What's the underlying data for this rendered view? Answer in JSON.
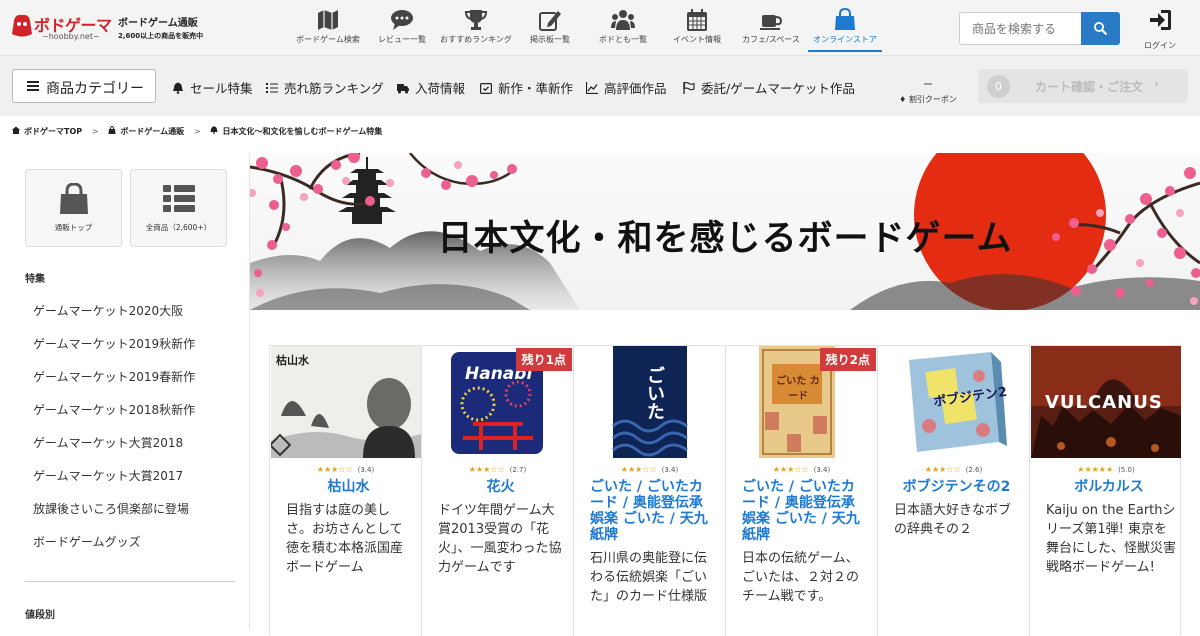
{
  "header": {
    "logo_text": "ボドゲーマ",
    "logo_sub": "~hoobby.net~",
    "tagline_title": "ボードゲーム通販",
    "tagline_sub": "2,600以上の商品を販売中",
    "nav": [
      {
        "label": "ボードゲーム検索",
        "icon": "map-icon"
      },
      {
        "label": "レビュー一覧",
        "icon": "comment-icon"
      },
      {
        "label": "おすすめランキング",
        "icon": "trophy-icon"
      },
      {
        "label": "掲示板一覧",
        "icon": "edit-icon"
      },
      {
        "label": "ボドとも一覧",
        "icon": "users-icon"
      },
      {
        "label": "イベント情報",
        "icon": "calendar-icon"
      },
      {
        "label": "カフェ/スペース",
        "icon": "coffee-icon"
      },
      {
        "label": "オンラインストア",
        "icon": "shopping-bag-icon",
        "active": true
      }
    ],
    "search_placeholder": "商品を検索する",
    "login_label": "ログイン"
  },
  "subbar": {
    "category_button": "商品カテゴリー",
    "links": [
      {
        "label": "セール特集",
        "icon": "bell-icon"
      },
      {
        "label": "売れ筋ランキング",
        "icon": "list-icon"
      },
      {
        "label": "入荷情報",
        "icon": "truck-icon"
      },
      {
        "label": "新作・準新作",
        "icon": "calendar-check-icon"
      },
      {
        "label": "高評価作品",
        "icon": "chart-icon"
      },
      {
        "label": "委託/ゲームマーケット作品",
        "icon": "flag-icon"
      }
    ],
    "coupon_dash": "ー",
    "coupon_label": "割引クーポン",
    "cart_count": "0",
    "cart_label": "カート確認・ご注文",
    "cart_chevron": "›"
  },
  "breadcrumb": [
    "ボドゲーマTOP",
    "ボードゲーム通販",
    "日本文化～和文化を愉しむボードゲーム特集"
  ],
  "breadcrumb_sep": ">",
  "sidebar": {
    "tiles": [
      {
        "label": "通販トップ",
        "icon": "shopping-bag-icon"
      },
      {
        "label": "全商品（2,600+）",
        "icon": "list-icon"
      }
    ],
    "section_title": "特集",
    "items": [
      "ゲームマーケット2020大阪",
      "ゲームマーケット2019秋新作",
      "ゲームマーケット2019春新作",
      "ゲームマーケット2018秋新作",
      "ゲームマーケット大賞2018",
      "ゲームマーケット大賞2017",
      "放課後さいころ倶楽部に登場",
      "ボードゲームグッズ"
    ],
    "section2_title": "値段別"
  },
  "hero": {
    "title": "日本文化・和を感じるボードゲーム"
  },
  "products": [
    {
      "name": "枯山水",
      "rating": 3.4,
      "rating_text": "(3.4)",
      "stars": "★★★☆☆",
      "stock": "",
      "desc": "目指すは庭の美しさ。お坊さんとして徳を積む本格派国産ボードゲーム",
      "cover_text": "枯山水"
    },
    {
      "name": "花火",
      "rating": 2.7,
      "rating_text": "(2.7)",
      "stars": "★★★☆☆",
      "stock": "残り1点",
      "desc": "ドイツ年間ゲーム大賞2013受賞の「花火」、一風変わった協力ゲームです",
      "cover_text": "Hanabi"
    },
    {
      "name": "ごいた / ごいたカード / 奥能登伝承娯楽 ごいた / 天九紙牌",
      "rating": 3.4,
      "rating_text": "(3.4)",
      "stars": "★★★☆☆",
      "stock": "",
      "desc": "石川県の奥能登に伝わる伝統娯楽「ごいた」のカード仕様版",
      "cover_text": "ごいた"
    },
    {
      "name": "ごいた / ごいたカード / 奥能登伝承娯楽 ごいた / 天九紙牌",
      "rating": 3.4,
      "rating_text": "(3.4)",
      "stars": "★★★☆☆",
      "stock": "残り2点",
      "desc": "日本の伝統ゲーム、ごいたは、２対２のチーム戦です。",
      "cover_text": "ごいた カード"
    },
    {
      "name": "ボブジテンその2",
      "rating": 2.6,
      "rating_text": "(2.6)",
      "stars": "★★★☆☆",
      "stock": "",
      "desc": "日本語大好きなボブの辞典その２",
      "cover_text": "ボブジテン2"
    },
    {
      "name": "ボルカルス",
      "rating": 5.0,
      "rating_text": "(5.0)",
      "stars": "★★★★★",
      "stock": "",
      "desc": "Kaiju on the Earthシリーズ第1弾! 東京を舞台にした、怪獣災害戦略ボードゲーム!",
      "cover_text": "VULCANUS"
    }
  ],
  "colors": {
    "accent": "#1e7ad0",
    "brand": "#d2232a",
    "stock_badge": "#d13b3b",
    "star": "#e5a21b"
  }
}
